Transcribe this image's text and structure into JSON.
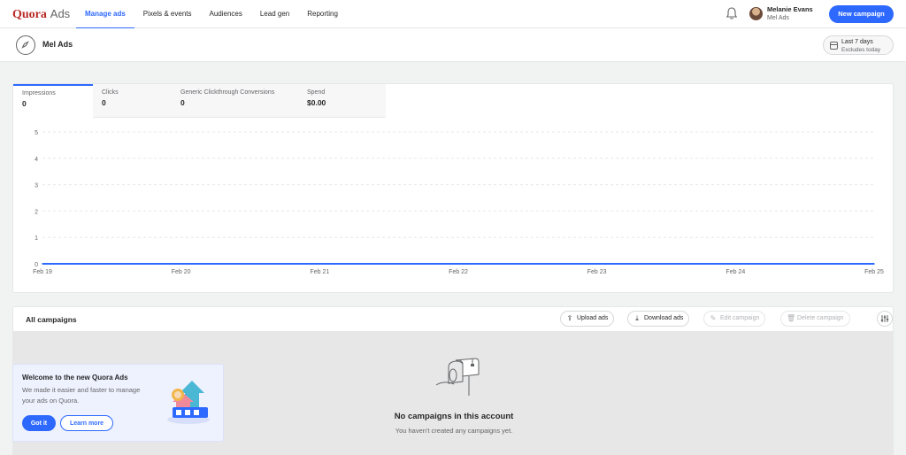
{
  "brand": {
    "name": "Quora",
    "product": "Ads"
  },
  "nav": {
    "items": [
      {
        "label": "Manage ads",
        "active": true
      },
      {
        "label": "Pixels & events",
        "active": false
      },
      {
        "label": "Audiences",
        "active": false
      },
      {
        "label": "Lead gen",
        "active": false
      },
      {
        "label": "Reporting",
        "active": false
      }
    ]
  },
  "user": {
    "name": "Melanie Evans",
    "account": "Mel Ads"
  },
  "new_campaign_label": "New campaign",
  "account": {
    "title": "Mel Ads"
  },
  "date_range": {
    "label": "Last 7 days",
    "note": "Excludes today"
  },
  "metrics": [
    {
      "label": "Impressions",
      "value": "0",
      "active": true
    },
    {
      "label": "Clicks",
      "value": "0",
      "active": false
    },
    {
      "label": "Generic Clickthrough Conversions",
      "value": "0",
      "active": false
    },
    {
      "label": "Spend",
      "value": "$0.00",
      "active": false
    }
  ],
  "chart_data": {
    "type": "line",
    "x": [
      "Feb 19",
      "Feb 20",
      "Feb 21",
      "Feb 22",
      "Feb 23",
      "Feb 24",
      "Feb 25"
    ],
    "series": [
      {
        "values": [
          0,
          0,
          0,
          0,
          0,
          0,
          0
        ]
      }
    ],
    "ylim": [
      0,
      5
    ],
    "yticks": [
      "0",
      "1",
      "2",
      "3",
      "4",
      "5"
    ],
    "grid": true,
    "line_color": "#2e69ff"
  },
  "campaigns": {
    "title": "All campaigns",
    "toolbar": {
      "upload": "Upload ads",
      "download": "Download ads",
      "edit": "Edit campaign",
      "delete": "Delete campaign"
    },
    "empty_title": "No campaigns in this account",
    "empty_sub": "You haven't created any campaigns yet."
  },
  "welcome": {
    "title": "Welcome to the new Quora Ads",
    "description": "We made it easier and faster to manage your ads on Quora.",
    "got_it": "Got it",
    "learn_more": "Learn more"
  },
  "colors": {
    "accent": "#2e69ff",
    "brand": "#b92b27"
  }
}
